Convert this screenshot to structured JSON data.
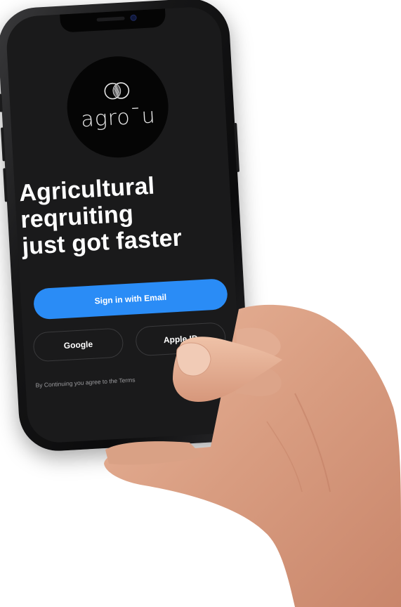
{
  "app": {
    "wordmark": "agro¯u",
    "logo_icon": "overlapping-circles-icon"
  },
  "headline": {
    "line1": "Agricultural",
    "line2": "reqruiting",
    "line3": "just got faster"
  },
  "buttons": {
    "email_label": "Sign in with Email",
    "google_label": "Google",
    "apple_label": "Apple ID"
  },
  "terms": {
    "text": "By Continuing you agree to the Terms"
  },
  "colors": {
    "screen_bg": "#1a1a1b",
    "accent_blue": "#2a8cf6",
    "text_white": "#ffffff"
  }
}
